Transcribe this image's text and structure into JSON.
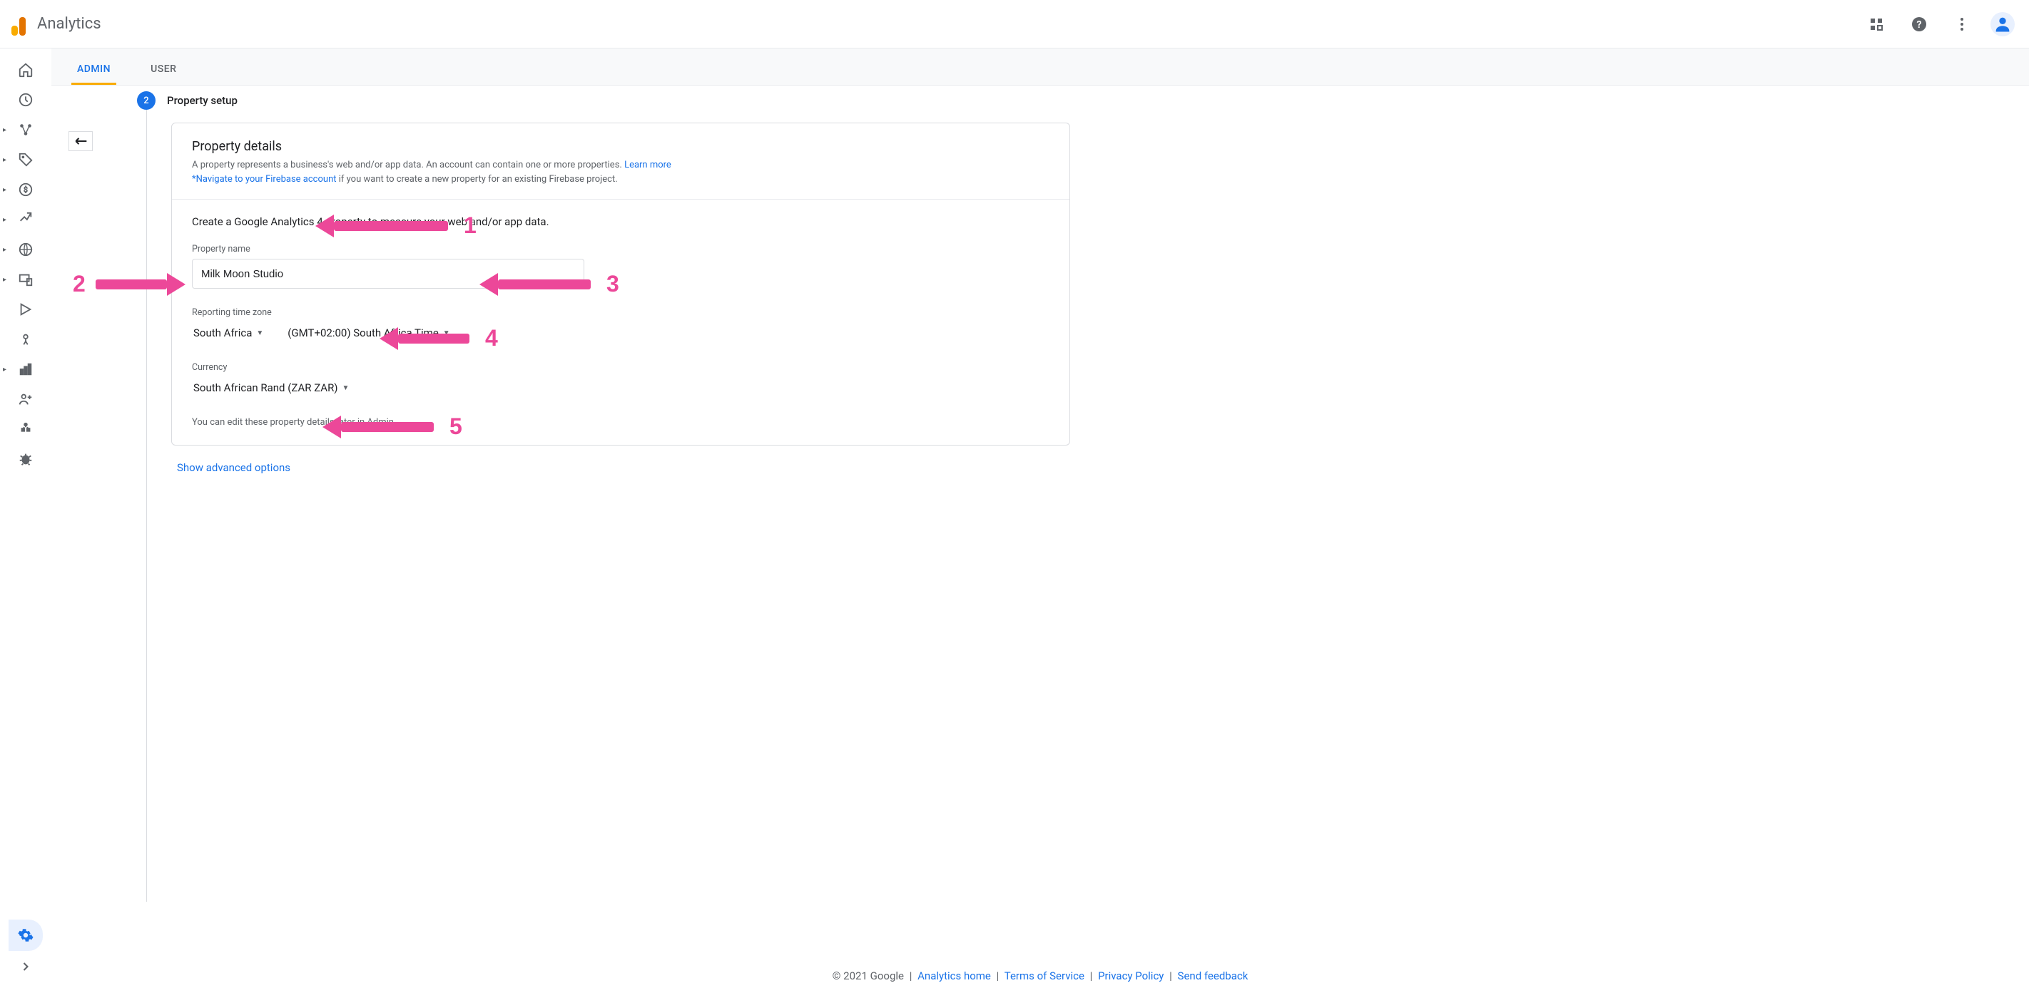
{
  "header": {
    "product_name": "Analytics"
  },
  "tabs": {
    "admin": "ADMIN",
    "user": "USER"
  },
  "step": {
    "number": "2",
    "title": "Property setup"
  },
  "card": {
    "section_title": "Property details",
    "desc_1": "A property represents a business's web and/or app data. An account can contain one or more properties. ",
    "learn_more": "Learn more",
    "firebase_prefix": "*Navigate to your Firebase account",
    "firebase_suffix": " if you want to create a new property for an existing Firebase project.",
    "intro": "Create a Google Analytics 4 property to measure your web and/or app data.",
    "property_name_label": "Property name",
    "property_name_value": "Milk Moon Studio",
    "tz_label": "Reporting time zone",
    "tz_country": "South Africa",
    "tz_value": "(GMT+02:00) South Africa Time",
    "currency_label": "Currency",
    "currency_value": "South African Rand (ZAR ZAR)",
    "edit_note": "You can edit these property details later in Admin"
  },
  "advanced_link": "Show advanced options",
  "footer": {
    "copyright_prefix": "© 2021 Google",
    "links": {
      "home": "Analytics home",
      "tos": "Terms of Service",
      "privacy": "Privacy Policy",
      "feedback": "Send feedback"
    }
  },
  "annotations": {
    "n1": "1",
    "n2": "2",
    "n3": "3",
    "n4": "4",
    "n5": "5"
  }
}
